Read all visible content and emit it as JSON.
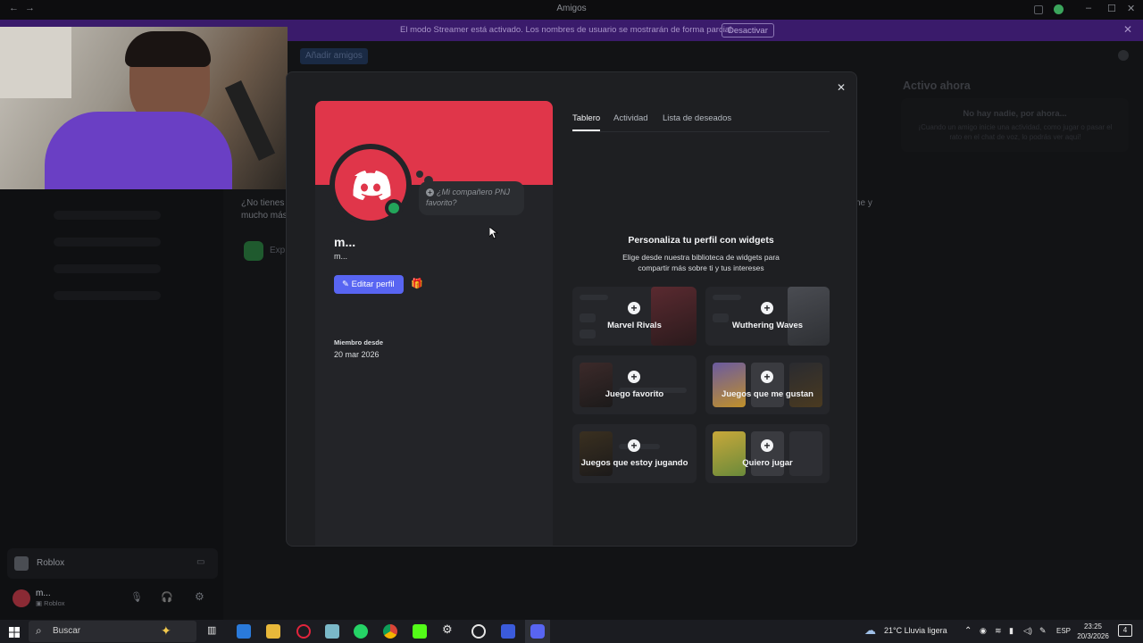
{
  "window": {
    "title": "Amigos"
  },
  "streamer_banner": {
    "text": "El modo Streamer está activado. Los nombres de usuario se mostrarán de forma parcial.",
    "button": "Desactivar"
  },
  "header": {
    "add_friends": "Añadir amigos"
  },
  "background": {
    "empty_text_1": "¿No tienes",
    "empty_text_2": "mucho más",
    "explore": "Exp",
    "right_edge_1": "ne y",
    "server_name": "Roblox"
  },
  "active_now": {
    "title": "Activo ahora",
    "empty_heading": "No hay nadie, por ahora...",
    "empty_text": "¡Cuando un amigo inicie una actividad, como jugar o pasar el rato en el chat de voz, lo podrás ver aquí!"
  },
  "profile": {
    "display_name": "m...",
    "username": "m...",
    "npc_bubble": "¿Mi compañero PNJ favorito?",
    "edit_button": "Editar perfil",
    "member_since_label": "Miembro desde",
    "member_since_date": "20 mar 2026",
    "avatar_color": "#e0364a",
    "status": "online"
  },
  "tabs": [
    "Tablero",
    "Actividad",
    "Lista de deseados"
  ],
  "widgets": {
    "title": "Personaliza tu perfil con widgets",
    "description": "Elige desde nuestra biblioteca de widgets para compartir más sobre ti y tus intereses",
    "cards": [
      "Marvel Rivals",
      "Wuthering Waves",
      "Juego favorito",
      "Juegos que me gustan",
      "Juegos que estoy jugando",
      "Quiero jugar"
    ]
  },
  "user_panel": {
    "name": "m...",
    "activity": "Roblox"
  },
  "taskbar": {
    "search": "Buscar",
    "weather": "21°C  Lluvia ligera",
    "language": "ESP",
    "time": "23:25",
    "date": "20/3/2026",
    "notifications": "4"
  }
}
